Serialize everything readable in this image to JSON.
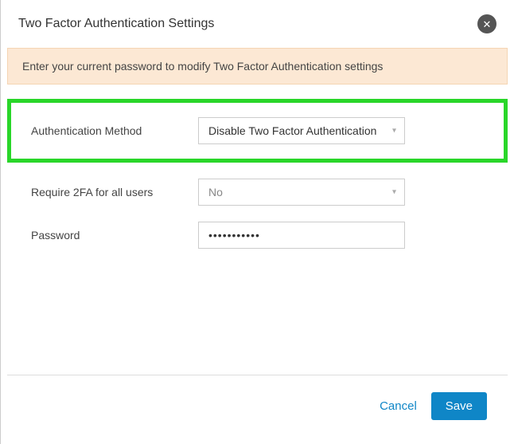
{
  "header": {
    "title": "Two Factor Authentication Settings"
  },
  "banner": {
    "text": "Enter your current password to modify Two Factor Authentication settings"
  },
  "form": {
    "auth_method": {
      "label": "Authentication Method",
      "value": "Disable Two Factor Authentication"
    },
    "require_all": {
      "label": "Require 2FA for all users",
      "value": "No"
    },
    "password": {
      "label": "Password",
      "value": "•••••••••••"
    }
  },
  "footer": {
    "cancel": "Cancel",
    "save": "Save"
  }
}
